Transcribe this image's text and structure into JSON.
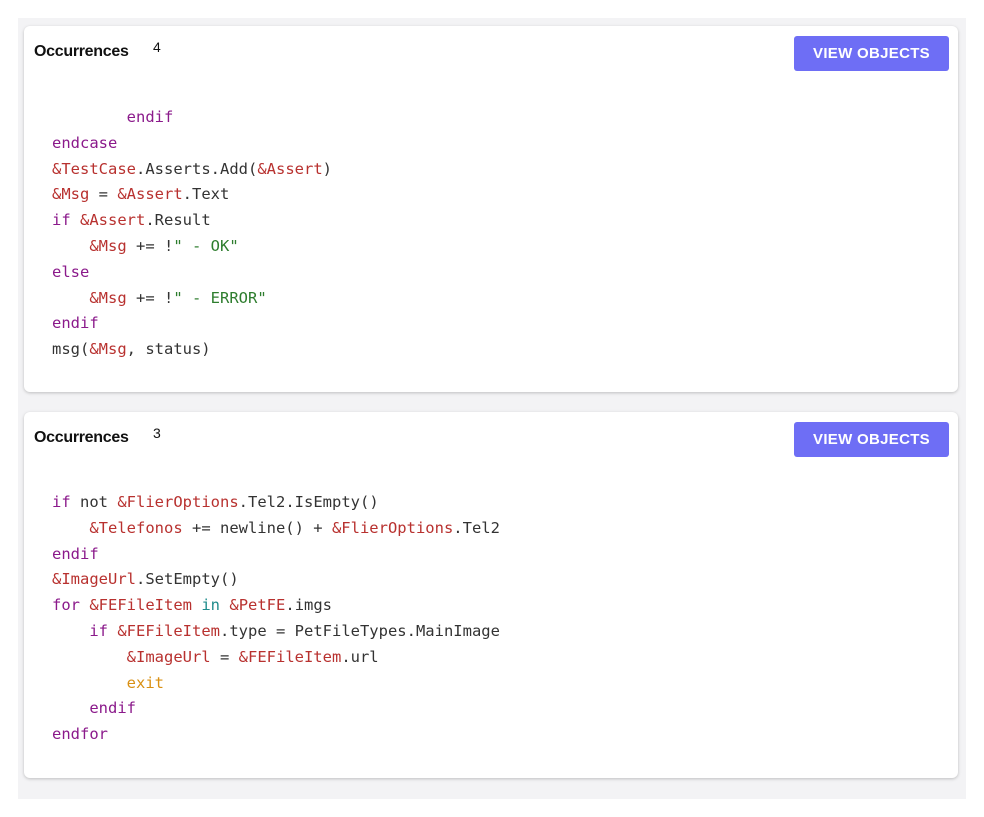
{
  "blocks": [
    {
      "occurrences_label": "Occurrences",
      "occurrences_count": "4",
      "button_label": "VIEW OBJECTS",
      "lines": [
        [
          {
            "t": "        "
          },
          {
            "t": "endif",
            "c": "kw"
          }
        ],
        [
          {
            "t": "endcase",
            "c": "kw"
          }
        ],
        [
          {
            "t": "&TestCase",
            "c": "var"
          },
          {
            "t": ".Asserts.Add("
          },
          {
            "t": "&Assert",
            "c": "var"
          },
          {
            "t": ")"
          }
        ],
        [
          {
            "t": "&Msg",
            "c": "var"
          },
          {
            "t": " = "
          },
          {
            "t": "&Assert",
            "c": "var"
          },
          {
            "t": ".Text"
          }
        ],
        [
          {
            "t": "if",
            "c": "kw"
          },
          {
            "t": " "
          },
          {
            "t": "&Assert",
            "c": "var"
          },
          {
            "t": ".Result"
          }
        ],
        [
          {
            "t": "    "
          },
          {
            "t": "&Msg",
            "c": "var"
          },
          {
            "t": " += !"
          },
          {
            "t": "\" - OK\"",
            "c": "str"
          }
        ],
        [
          {
            "t": "else",
            "c": "kw"
          }
        ],
        [
          {
            "t": "    "
          },
          {
            "t": "&Msg",
            "c": "var"
          },
          {
            "t": " += !"
          },
          {
            "t": "\" - ERROR\"",
            "c": "str"
          }
        ],
        [
          {
            "t": "endif",
            "c": "kw"
          }
        ],
        [
          {
            "t": "msg("
          },
          {
            "t": "&Msg",
            "c": "var"
          },
          {
            "t": ", status)"
          }
        ]
      ]
    },
    {
      "occurrences_label": "Occurrences",
      "occurrences_count": "3",
      "button_label": "VIEW OBJECTS",
      "lines": [
        [
          {
            "t": "if",
            "c": "kw"
          },
          {
            "t": " not "
          },
          {
            "t": "&FlierOptions",
            "c": "var"
          },
          {
            "t": ".Tel2.IsEmpty()"
          }
        ],
        [
          {
            "t": "    "
          },
          {
            "t": "&Telefonos",
            "c": "var"
          },
          {
            "t": " += newline() + "
          },
          {
            "t": "&FlierOptions",
            "c": "var"
          },
          {
            "t": ".Tel2"
          }
        ],
        [
          {
            "t": "endif",
            "c": "kw"
          }
        ],
        [
          {
            "t": "&ImageUrl",
            "c": "var"
          },
          {
            "t": ".SetEmpty()"
          }
        ],
        [
          {
            "t": "for",
            "c": "kw"
          },
          {
            "t": " "
          },
          {
            "t": "&FEFileItem",
            "c": "var"
          },
          {
            "t": " "
          },
          {
            "t": "in",
            "c": "op"
          },
          {
            "t": " "
          },
          {
            "t": "&PetFE",
            "c": "var"
          },
          {
            "t": ".imgs"
          }
        ],
        [
          {
            "t": "    "
          },
          {
            "t": "if",
            "c": "kw"
          },
          {
            "t": " "
          },
          {
            "t": "&FEFileItem",
            "c": "var"
          },
          {
            "t": ".type = PetFileTypes.MainImage"
          }
        ],
        [
          {
            "t": "        "
          },
          {
            "t": "&ImageUrl",
            "c": "var"
          },
          {
            "t": " = "
          },
          {
            "t": "&FEFileItem",
            "c": "var"
          },
          {
            "t": ".url"
          }
        ],
        [
          {
            "t": "        "
          },
          {
            "t": "exit",
            "c": "ex"
          }
        ],
        [
          {
            "t": "    "
          },
          {
            "t": "endif",
            "c": "kw"
          }
        ],
        [
          {
            "t": "endfor",
            "c": "kw"
          }
        ]
      ]
    }
  ],
  "colors": {
    "keyword": "#8b1a8b",
    "variable": "#b8312f",
    "string": "#2e7d2e",
    "operator": "#1f8c8c",
    "exit": "#d99013",
    "button": "#6e6ef5"
  }
}
